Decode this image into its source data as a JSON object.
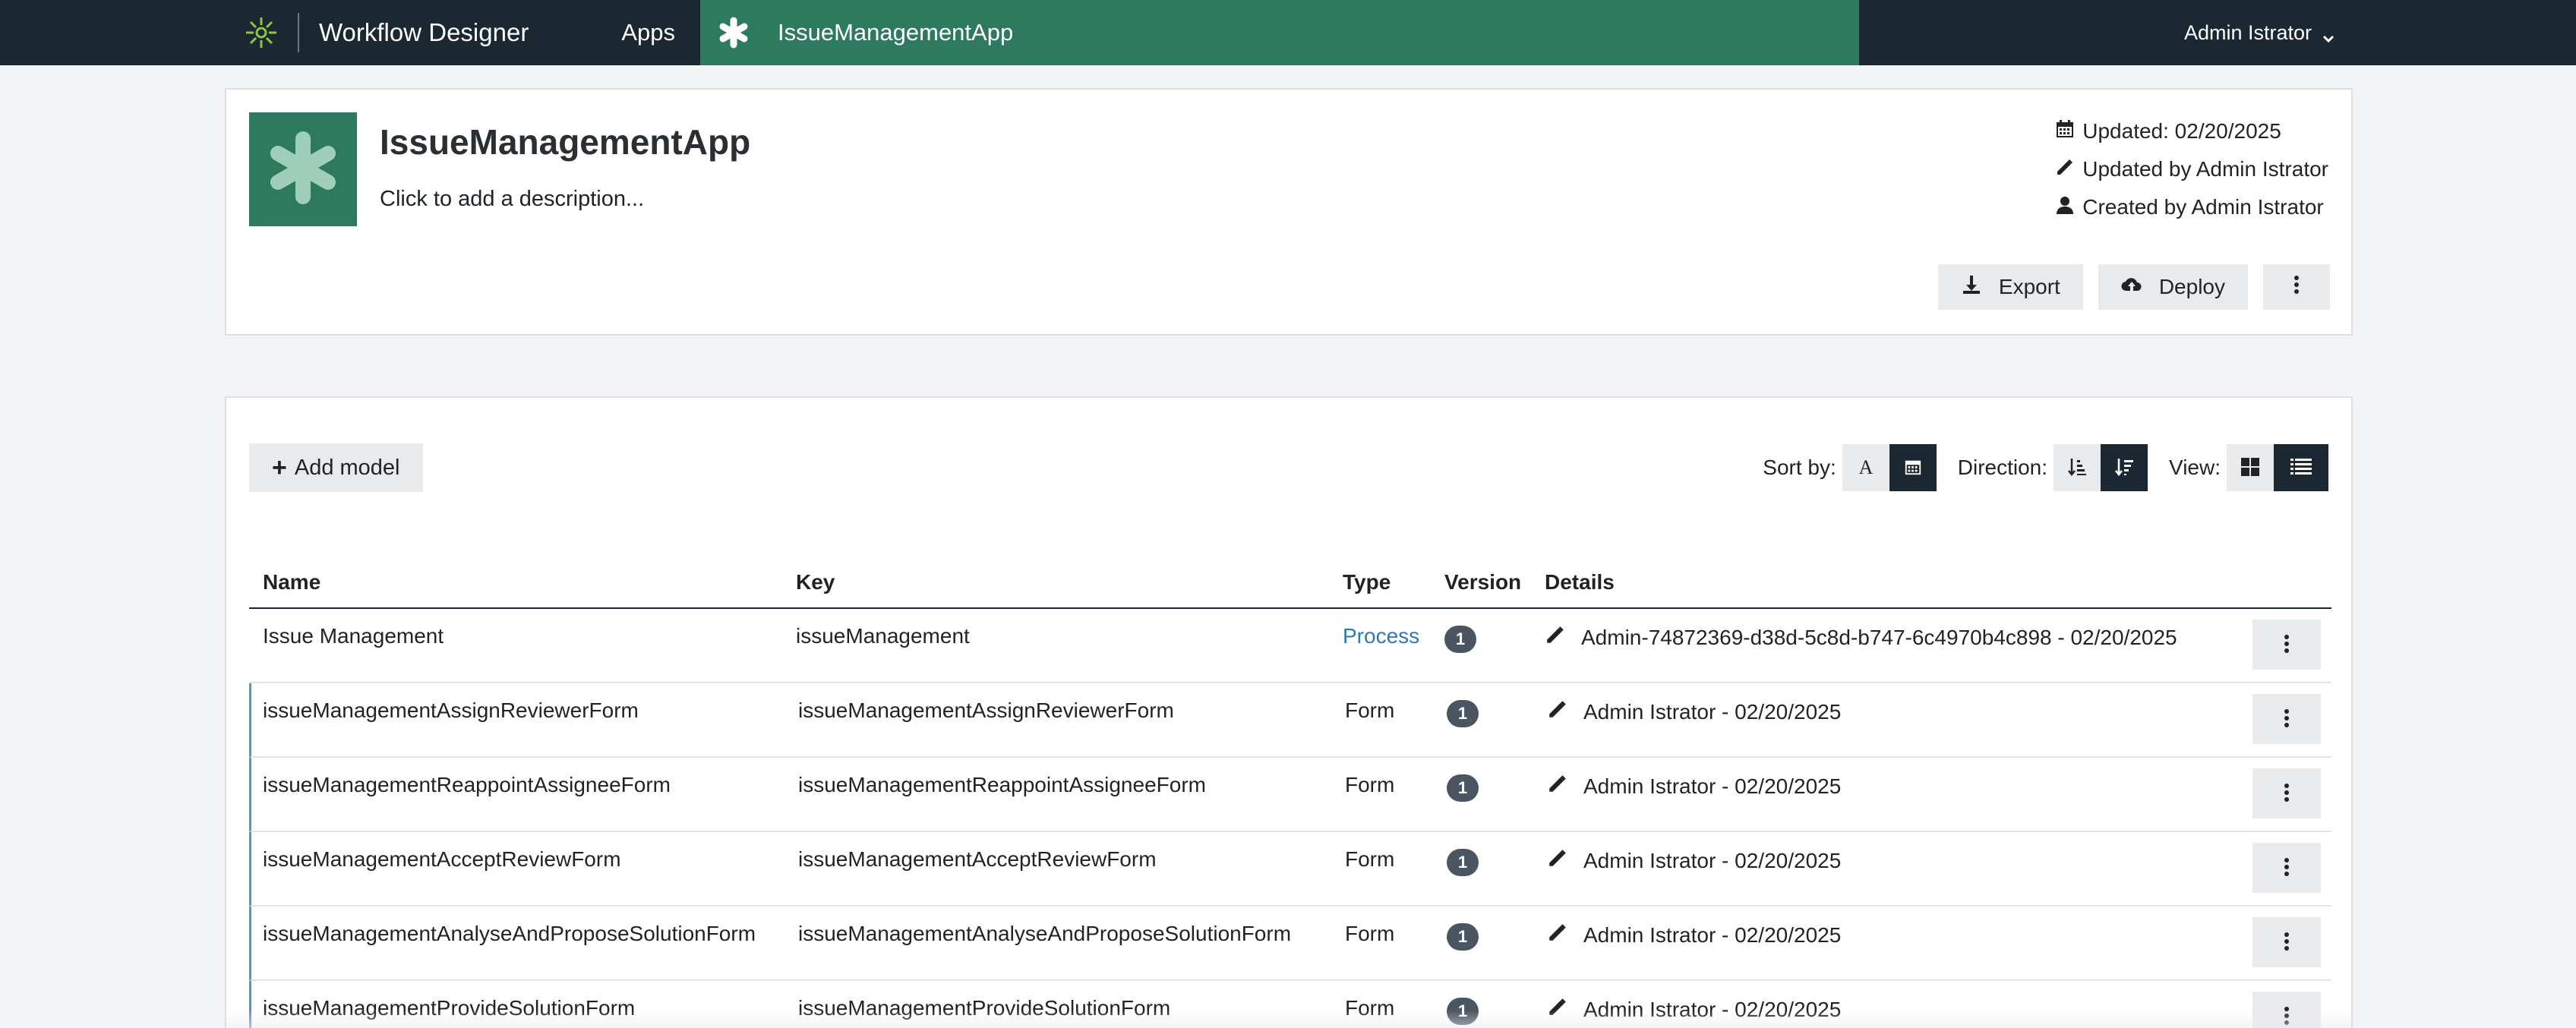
{
  "topbar": {
    "brand_title": "Workflow Designer",
    "nav_apps": "Apps",
    "app_tab": "IssueManagementApp",
    "user": "Admin Istrator"
  },
  "header": {
    "app_name": "IssueManagementApp",
    "description": "Click to add a description...",
    "updated": "Updated: 02/20/2025",
    "updated_by": "Updated by Admin Istrator",
    "created_by": "Created by Admin Istrator",
    "export_label": "Export",
    "deploy_label": "Deploy"
  },
  "toolbar": {
    "add_model": "Add model",
    "sort_by": "Sort by:",
    "direction": "Direction:",
    "view": "View:",
    "sort_active": "date",
    "direction_active": "descending",
    "view_active": "list"
  },
  "table": {
    "headers": {
      "name": "Name",
      "key": "Key",
      "type": "Type",
      "version": "Version",
      "details": "Details"
    },
    "rows": [
      {
        "name": "Issue Management",
        "key": "issueManagement",
        "type": "Process",
        "version": "1",
        "details": "Admin-74872369-d38d-5c8d-b747-6c4970b4c898 - 02/20/2025"
      },
      {
        "name": "issueManagementAssignReviewerForm",
        "key": "issueManagementAssignReviewerForm",
        "type": "Form",
        "version": "1",
        "details": "Admin Istrator - 02/20/2025"
      },
      {
        "name": "issueManagementReappointAssigneeForm",
        "key": "issueManagementReappointAssigneeForm",
        "type": "Form",
        "version": "1",
        "details": "Admin Istrator - 02/20/2025"
      },
      {
        "name": "issueManagementAcceptReviewForm",
        "key": "issueManagementAcceptReviewForm",
        "type": "Form",
        "version": "1",
        "details": "Admin Istrator - 02/20/2025"
      },
      {
        "name": "issueManagementAnalyseAndProposeSolutionForm",
        "key": "issueManagementAnalyseAndProposeSolutionForm",
        "type": "Form",
        "version": "1",
        "details": "Admin Istrator - 02/20/2025"
      },
      {
        "name": "issueManagementProvideSolutionForm",
        "key": "issueManagementProvideSolutionForm",
        "type": "Form",
        "version": "1",
        "details": "Admin Istrator - 02/20/2025"
      }
    ]
  },
  "colors": {
    "topbar": "#1b2731",
    "accent_green": "#2e7a5e",
    "link_blue": "#2f78b8"
  }
}
